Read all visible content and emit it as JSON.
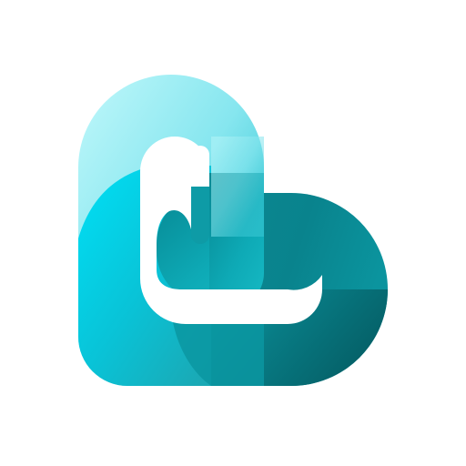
{
  "logo": {
    "icon": "interlocked-loops-logo-icon",
    "colors": {
      "background": "#ffffff",
      "light_cyan": "#a6f1f6",
      "bright_cyan": "#00d8f2",
      "mid_teal": "#19a9b8",
      "deep_teal": "#067b86",
      "dark_teal": "#045a61"
    }
  }
}
